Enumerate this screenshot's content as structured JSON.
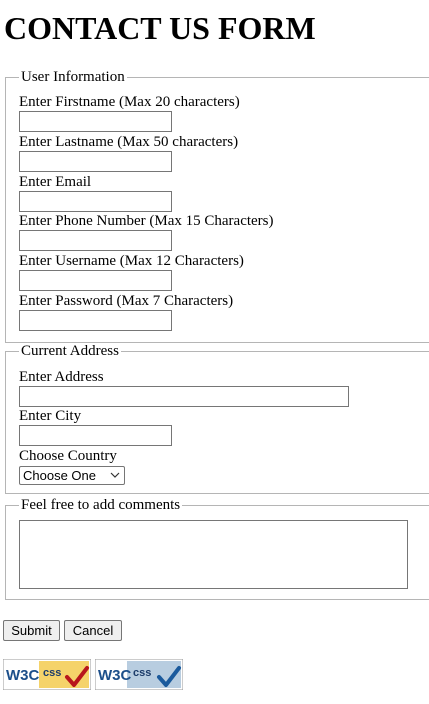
{
  "page": {
    "title": "CONTACT US FORM"
  },
  "user_info": {
    "legend": "User Information",
    "firstname_label": "Enter Firstname (Max 20 characters)",
    "firstname_value": "",
    "lastname_label": "Enter Lastname (Max 50 characters)",
    "lastname_value": "",
    "email_label": "Enter Email",
    "email_value": "",
    "phone_label": "Enter Phone Number (Max 15 Characters)",
    "phone_value": "",
    "username_label": "Enter Username (Max 12 Characters)",
    "username_value": "",
    "password_label": "Enter Password (Max 7 Characters)",
    "password_value": ""
  },
  "address": {
    "legend": "Current Address",
    "address_label": "Enter Address",
    "address_value": "",
    "city_label": "Enter City",
    "city_value": "",
    "country_label": "Choose Country",
    "country_selected": "Choose One"
  },
  "comments": {
    "legend": "Feel free to add comments",
    "value": ""
  },
  "buttons": {
    "submit_label": "Submit",
    "cancel_label": "Cancel"
  },
  "badges": {
    "w3c_text": "W3C",
    "css_text": "css",
    "badge1_bg": "#f5d36a",
    "badge2_bg": "#b8cde0",
    "badge1_check": "#b8161c",
    "badge2_check": "#1b5a9c"
  }
}
